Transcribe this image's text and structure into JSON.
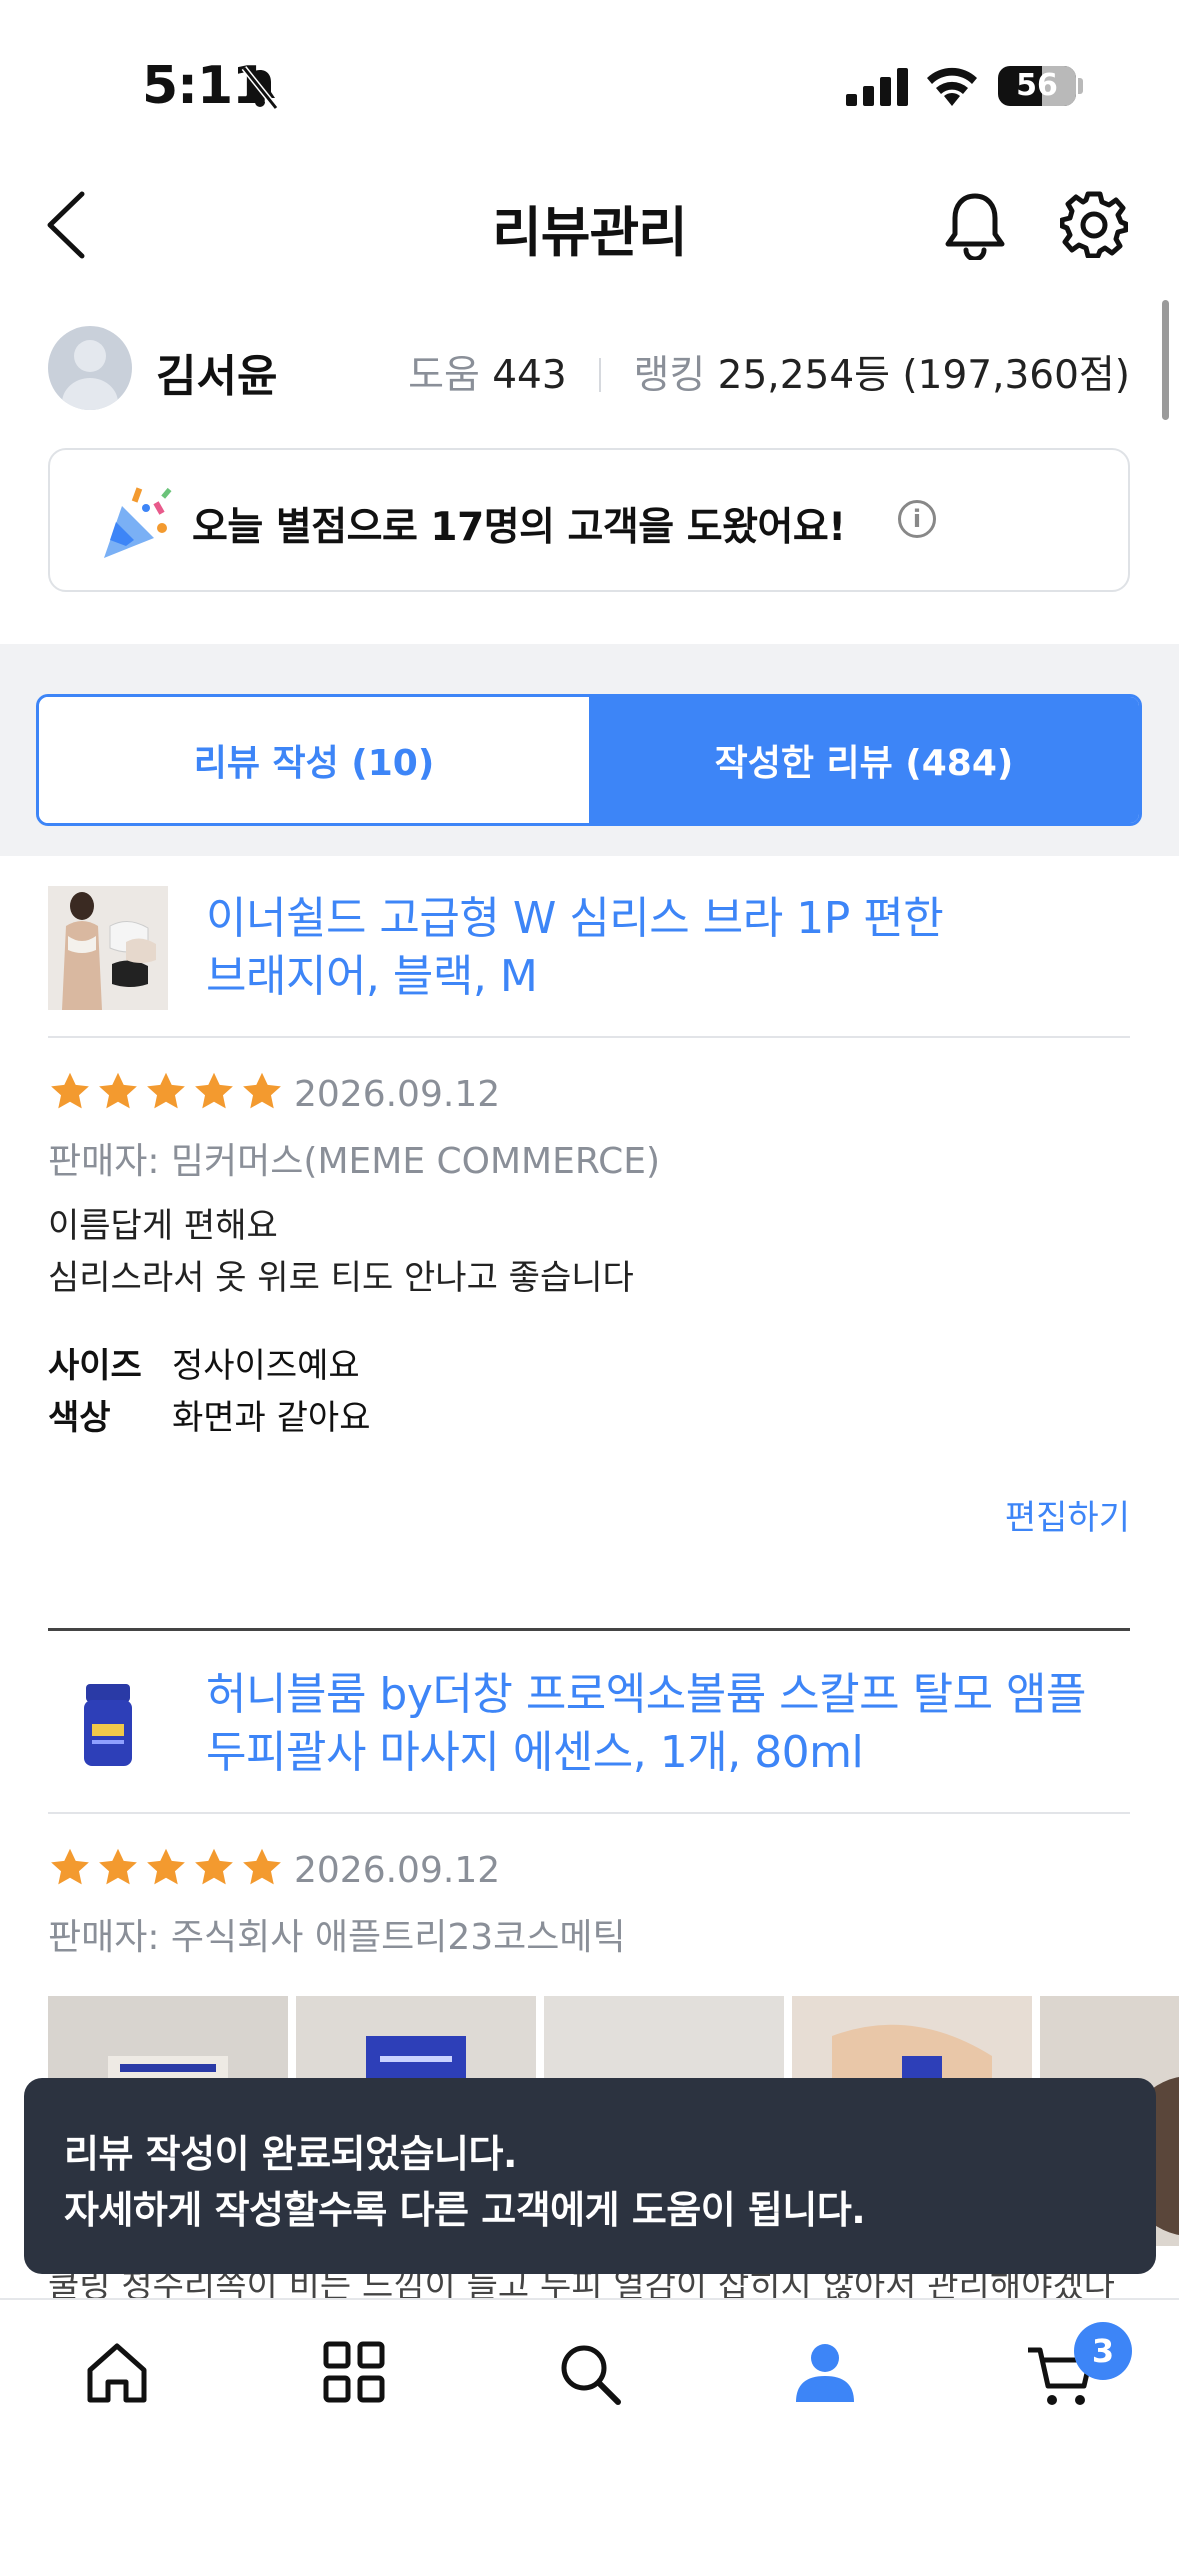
{
  "status_bar": {
    "time": "5:11",
    "battery": "56"
  },
  "header": {
    "title": "리뷰관리"
  },
  "profile": {
    "name": "김서윤",
    "help_label": "도움",
    "help_value": "443",
    "rank_label": "랭킹",
    "rank_value": "25,254등 (197,360점)"
  },
  "banner": {
    "message": "오늘 별점으로 17명의 고객을 도왔어요!",
    "info": "i"
  },
  "tabs": [
    {
      "label": "리뷰 작성 (10)",
      "active": false
    },
    {
      "label": "작성한 리뷰 (484)",
      "active": true
    }
  ],
  "reviews": [
    {
      "title_line1": "이너쉴드 고급형 W 심리스 브라 1P 편한",
      "title_line2": "브래지어, 블랙, M",
      "rating": 5,
      "date": "2026.09.12",
      "seller": "판매자: 밈커머스(MEME COMMERCE)",
      "body_line1": "이름답게 편해요",
      "body_line2": "심리스라서 옷 위로 티도 안나고 좋습니다",
      "attributes": [
        {
          "key": "사이즈",
          "value": "정사이즈예요"
        },
        {
          "key": "색상",
          "value": "화면과 같아요"
        }
      ],
      "edit_label": "편집하기"
    },
    {
      "title_line1": "허니블룸 by더창 프로엑소볼륨 스칼프 탈모 앰플",
      "title_line2": "두피괄사 마사지 에센스, 1개, 80ml",
      "rating": 5,
      "date": "2026.09.12",
      "seller": "판매자: 주식회사 애플트리23코스메틱",
      "partial_body": "쿨링 청수리쪽이 비는 느낌이 들고 두피 열감이 잡히지 않아서 관리해야겠다"
    }
  ],
  "toast": {
    "line1": "리뷰 작성이 완료되었습니다.",
    "line2": "자세하게 작성할수록 다른 고객에게 도움이 됩니다."
  },
  "bottom_nav": {
    "items": [
      "home-icon",
      "category-grid-icon",
      "search-icon",
      "my-page-icon",
      "cart-icon"
    ],
    "cart_count": "3"
  },
  "colors": {
    "accent": "#3d85f7",
    "star": "#f39a2f",
    "toast_bg": "#2c3340"
  }
}
